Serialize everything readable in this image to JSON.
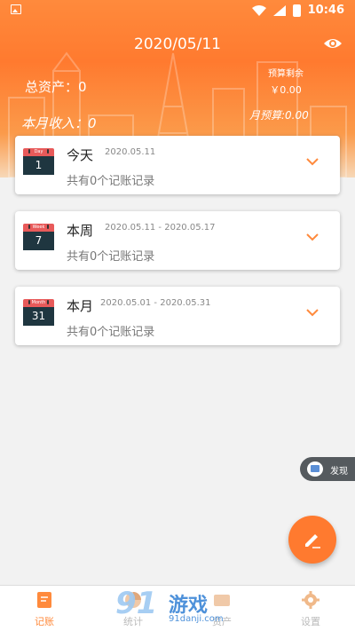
{
  "status_bar": {
    "time": "10:46",
    "icons": [
      "image-icon",
      "wifi-icon",
      "signal-icon",
      "battery-icon"
    ]
  },
  "header": {
    "date": "2020/05/11",
    "total_assets": "总资产：0",
    "budget_remaining_label": "预算剩余",
    "budget_remaining_value": "￥0.00",
    "monthly_income": "本月收入：0",
    "monthly_budget": "月预算:0.00"
  },
  "cards": [
    {
      "calendar_label": "Day",
      "calendar_number": "1",
      "title": "今天",
      "range": "2020.05.11",
      "summary": "共有0个记账记录"
    },
    {
      "calendar_label": "Week",
      "calendar_number": "7",
      "title": "本周",
      "range": "2020.05.11 - 2020.05.17",
      "summary": "共有0个记账记录"
    },
    {
      "calendar_label": "Month",
      "calendar_number": "31",
      "title": "本月",
      "range": "2020.05.01 - 2020.05.31",
      "summary": "共有0个记账记录"
    }
  ],
  "discover": {
    "label": "发现"
  },
  "tabs": [
    {
      "label": "记账",
      "icon": "ledger-icon",
      "active": true
    },
    {
      "label": "统计",
      "icon": "chart-icon",
      "active": false
    },
    {
      "label": "资产",
      "icon": "wallet-icon",
      "active": false
    },
    {
      "label": "设置",
      "icon": "gear-icon",
      "active": false
    }
  ],
  "watermark": {
    "number": "91",
    "text": "游戏",
    "url": "91danji.com"
  },
  "colors": {
    "accent": "#ff7a2f",
    "calendar_red": "#e85a5a",
    "calendar_dark": "#1f3640"
  }
}
